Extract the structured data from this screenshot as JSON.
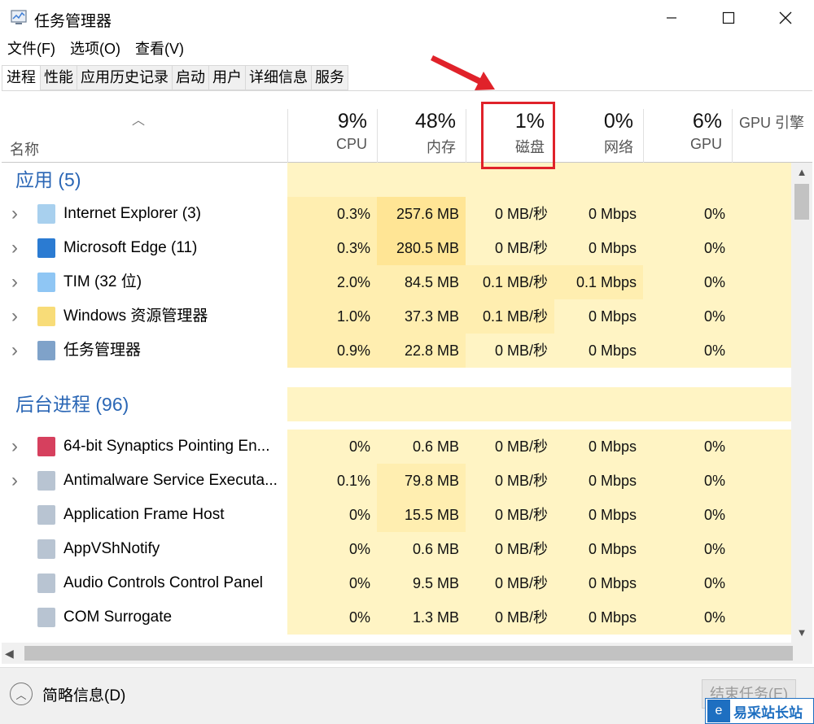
{
  "window": {
    "title": "任务管理器"
  },
  "menu": [
    "文件(F)",
    "选项(O)",
    "查看(V)"
  ],
  "tabs": [
    "进程",
    "性能",
    "应用历史记录",
    "启动",
    "用户",
    "详细信息",
    "服务"
  ],
  "header": {
    "name_label": "名称",
    "columns": [
      {
        "pct": "9%",
        "label": "CPU"
      },
      {
        "pct": "48%",
        "label": "内存"
      },
      {
        "pct": "1%",
        "label": "磁盘"
      },
      {
        "pct": "0%",
        "label": "网络"
      },
      {
        "pct": "6%",
        "label": "GPU"
      },
      {
        "pct": "",
        "label": "GPU 引擎"
      }
    ]
  },
  "groups": {
    "apps": "应用 (5)",
    "background": "后台进程 (96)"
  },
  "apps": [
    {
      "name": "Internet Explorer (3)",
      "cpu": "0.3%",
      "mem": "257.6 MB",
      "disk": "0 MB/秒",
      "net": "0 Mbps",
      "gpu": "0%"
    },
    {
      "name": "Microsoft Edge (11)",
      "cpu": "0.3%",
      "mem": "280.5 MB",
      "disk": "0 MB/秒",
      "net": "0 Mbps",
      "gpu": "0%"
    },
    {
      "name": "TIM (32 位)",
      "cpu": "2.0%",
      "mem": "84.5 MB",
      "disk": "0.1 MB/秒",
      "net": "0.1 Mbps",
      "gpu": "0%"
    },
    {
      "name": "Windows 资源管理器",
      "cpu": "1.0%",
      "mem": "37.3 MB",
      "disk": "0.1 MB/秒",
      "net": "0 Mbps",
      "gpu": "0%"
    },
    {
      "name": "任务管理器",
      "cpu": "0.9%",
      "mem": "22.8 MB",
      "disk": "0 MB/秒",
      "net": "0 Mbps",
      "gpu": "0%"
    }
  ],
  "background": [
    {
      "name": "64-bit Synaptics Pointing En...",
      "cpu": "0%",
      "mem": "0.6 MB",
      "disk": "0 MB/秒",
      "net": "0 Mbps",
      "gpu": "0%"
    },
    {
      "name": "Antimalware Service Executa...",
      "cpu": "0.1%",
      "mem": "79.8 MB",
      "disk": "0 MB/秒",
      "net": "0 Mbps",
      "gpu": "0%"
    },
    {
      "name": "Application Frame Host",
      "cpu": "0%",
      "mem": "15.5 MB",
      "disk": "0 MB/秒",
      "net": "0 Mbps",
      "gpu": "0%"
    },
    {
      "name": "AppVShNotify",
      "cpu": "0%",
      "mem": "0.6 MB",
      "disk": "0 MB/秒",
      "net": "0 Mbps",
      "gpu": "0%"
    },
    {
      "name": "Audio Controls Control Panel",
      "cpu": "0%",
      "mem": "9.5 MB",
      "disk": "0 MB/秒",
      "net": "0 Mbps",
      "gpu": "0%"
    },
    {
      "name": "COM Surrogate",
      "cpu": "0%",
      "mem": "1.3 MB",
      "disk": "0 MB/秒",
      "net": "0 Mbps",
      "gpu": "0%"
    }
  ],
  "footer": {
    "fewer_details": "简略信息(D)",
    "end_task": "结束任务(E)"
  },
  "watermark": "易采站长站",
  "colors": {
    "heat_light": "#fff4c4",
    "heat_mid": "#ffeeb0",
    "heat_strong": "#ffe595",
    "group_title": "#2a66b5",
    "highlight": "#e0222a"
  },
  "icons": [
    "task-manager-icon",
    "ie-icon",
    "edge-icon",
    "tim-icon",
    "explorer-icon",
    "synaptics-icon",
    "service-icon",
    "expand-chevron-icon",
    "sort-up-icon",
    "collapse-up-icon"
  ]
}
